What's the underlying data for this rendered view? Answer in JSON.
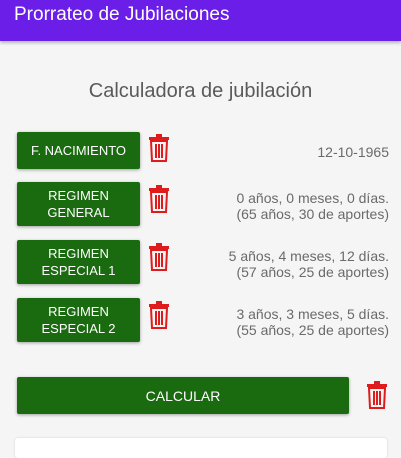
{
  "appbar": {
    "title": "Prorrateo de Jubilaciones"
  },
  "main": {
    "heading": "Calculadora de jubilación"
  },
  "rows": [
    {
      "button_label": "F. NACIMIENTO",
      "value_line1": "12-10-1965",
      "value_line2": ""
    },
    {
      "button_label_1": "REGIMEN",
      "button_label_2": "GENERAL",
      "value_line1": "0 años, 0 meses, 0 días.",
      "value_line2": "(65 años, 30 de aportes)"
    },
    {
      "button_label_1": "REGIMEN",
      "button_label_2": "ESPECIAL 1",
      "value_line1": "5 años, 4 meses, 12 días.",
      "value_line2": "(57 años, 25 de aportes)"
    },
    {
      "button_label_1": "REGIMEN",
      "button_label_2": "ESPECIAL 2",
      "value_line1": "3 años, 3 meses, 5 días.",
      "value_line2": "(55 años, 25 de aportes)"
    }
  ],
  "actions": {
    "calculate_label": "CALCULAR"
  },
  "icons": {
    "delete": "trash-icon"
  },
  "colors": {
    "appbar": "#6a1ee8",
    "button": "#1a6a10",
    "trash": "#e01b1b"
  }
}
